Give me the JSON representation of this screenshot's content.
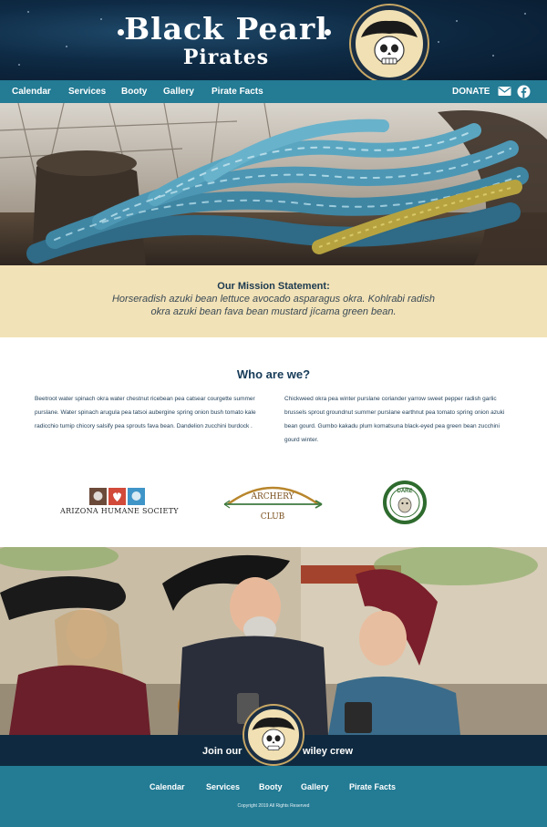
{
  "header": {
    "brand_line1": "Black Pearl",
    "brand_line2": "Pirates",
    "logo_icon": "pirate-skull-logo-icon"
  },
  "nav": {
    "items": [
      "Calendar",
      "Services",
      "Booty",
      "Gallery",
      "Pirate Facts"
    ],
    "donate_label": "DONATE",
    "email_icon": "envelope-icon",
    "social_icon": "facebook-icon"
  },
  "hero": {
    "image": "blue-rope-photo"
  },
  "mission": {
    "title": "Our Mission Statement:",
    "text": "Horseradish azuki bean lettuce avocado asparagus okra. Kohlrabi radish okra azuki bean fava bean mustard jícama green bean."
  },
  "about": {
    "title": "Who are we?",
    "col1": "Beetroot water spinach okra water chestnut ricebean pea catsear courgette summer purslane. Water spinach arugula pea tatsoi aubergine spring onion bush tomato kale radicchio tumip chicory salsify pea sprouts fava bean. Dandelion zucchini burdock .",
    "col2": "Chickweed okra pea winter purslane coriander yarrow sweet pepper radish garlic brussels sprout groundnut summer purslane earthnut pea tomato spring onion azuki bean gourd. Gumbo kakadu plum komatsuna black-eyed pea green bean zucchini gourd winter."
  },
  "partners": {
    "ahs": "ARIZONA HUMANE SOCIETY",
    "archery_top": "ARCHERY",
    "archery_bottom": "CLUB",
    "dare": "DARE"
  },
  "crew": {
    "image": "pirate-crew-photo",
    "join_left": "Join our",
    "join_right": "wiley crew"
  },
  "footer": {
    "items": [
      "Calendar",
      "Services",
      "Booty",
      "Gallery",
      "Pirate Facts"
    ],
    "copyright": "Copyright 2019 All Rights Reserved"
  },
  "colors": {
    "nav": "#237b94",
    "header_dark": "#0e2a44",
    "mission_bg": "#f2e2b7",
    "heading": "#163b58"
  }
}
